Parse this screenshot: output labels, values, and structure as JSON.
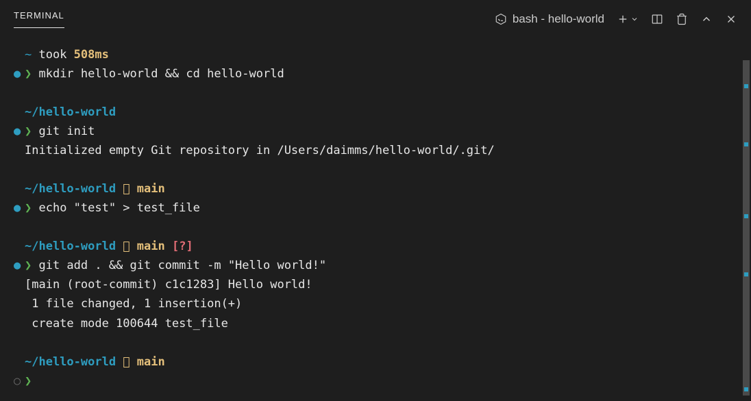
{
  "header": {
    "tab": "TERMINAL",
    "shell_info": "bash - hello-world"
  },
  "lines": {
    "l0_tilde": "~",
    "l0_took": " took ",
    "l0_time": "508ms",
    "l1_arrow": "❯",
    "l1_cmd": " mkdir hello-world && cd hello-world",
    "l2_path": "~/hello-world",
    "l3_arrow": "❯",
    "l3_cmd": " git init",
    "l4_output": "Initialized empty Git repository in /Users/daimms/hello-world/.git/",
    "l5_path": "~/hello-world",
    "l5_branch_icon": "  ",
    "l5_branch": "main",
    "l6_arrow": "❯",
    "l6_cmd": " echo \"test\" > test_file",
    "l7_path": "~/hello-world",
    "l7_branch_icon": "  ",
    "l7_branch": "main",
    "l7_status": " [?]",
    "l8_arrow": "❯",
    "l8_cmd": " git add . && git commit -m \"Hello world!\"",
    "l9_output": "[main (root-commit) c1c1283] Hello world!",
    "l10_output": " 1 file changed, 1 insertion(+)",
    "l11_output": " create mode 100644 test_file",
    "l12_path": "~/hello-world",
    "l12_branch_icon": "  ",
    "l12_branch": "main",
    "l13_arrow": "❯"
  },
  "bullets": {
    "filled": "●",
    "empty": "○"
  }
}
